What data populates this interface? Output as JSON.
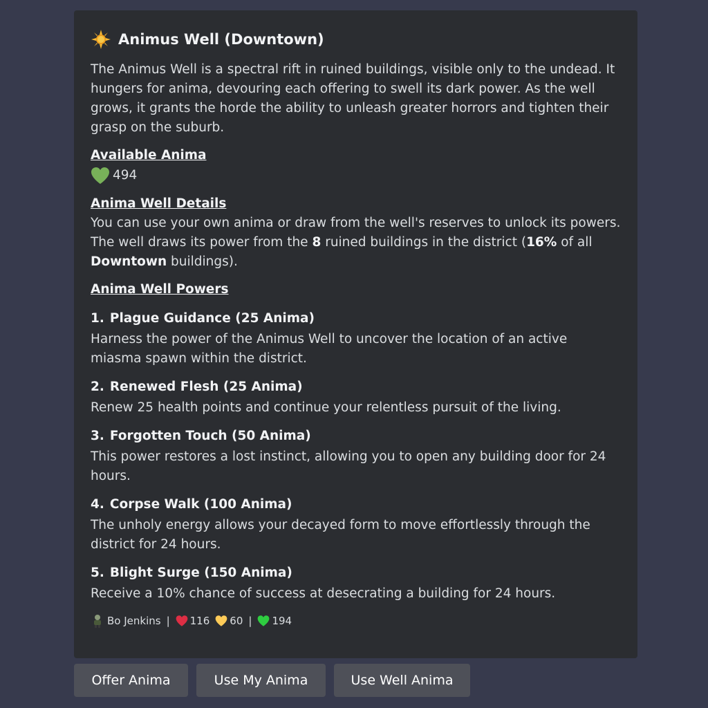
{
  "embed": {
    "title": "Animus Well (Downtown)",
    "title_icon": "sun-icon",
    "description": "The Animus Well is a spectral rift in ruined buildings, visible only to the undead. It hungers for anima, devouring each offering to swell its dark power. As the well grows, it grants the horde the ability to unleash greater horrors and tighten their grasp on the suburb.",
    "available": {
      "heading": "Available Anima",
      "icon": "green-heart-icon",
      "value": "494"
    },
    "details": {
      "heading": "Anima Well Details",
      "line1": "You can use your own anima or draw from the well's reserves to unlock its powers. The well draws its power from the ",
      "buildings": "8",
      "line2": " ruined buildings in the district (",
      "percent": "16%",
      "line3": " of all ",
      "district": "Downtown",
      "line4": " buildings)."
    },
    "powers": {
      "heading": "Anima Well Powers",
      "items": [
        {
          "num": "1.",
          "title": "Plague Guidance (25 Anima)",
          "desc": "Harness the power of the Animus Well to uncover the location of an active miasma spawn within the district."
        },
        {
          "num": "2.",
          "title": "Renewed Flesh (25 Anima)",
          "desc": "Renew 25 health points and continue your relentless pursuit of the living."
        },
        {
          "num": "3.",
          "title": "Forgotten Touch (50 Anima)",
          "desc": "This power restores a lost instinct, allowing you to open any building door for 24 hours."
        },
        {
          "num": "4.",
          "title": "Corpse Walk (100 Anima)",
          "desc": "The unholy energy allows your decayed form to move effortlessly through the district for 24 hours."
        },
        {
          "num": "5.",
          "title": "Blight Surge (150 Anima)",
          "desc": "Receive a 10% chance of success at desecrating a building for 24 hours."
        }
      ]
    },
    "footer": {
      "name": "Bo Jenkins",
      "sep": "|",
      "health": "116",
      "gold": "60",
      "anima": "194"
    }
  },
  "buttons": {
    "offer": "Offer Anima",
    "use_mine": "Use My Anima",
    "use_well": "Use Well Anima"
  },
  "colors": {
    "background": "#373a4d",
    "embed": "#2b2d31",
    "button": "#4e5058"
  }
}
